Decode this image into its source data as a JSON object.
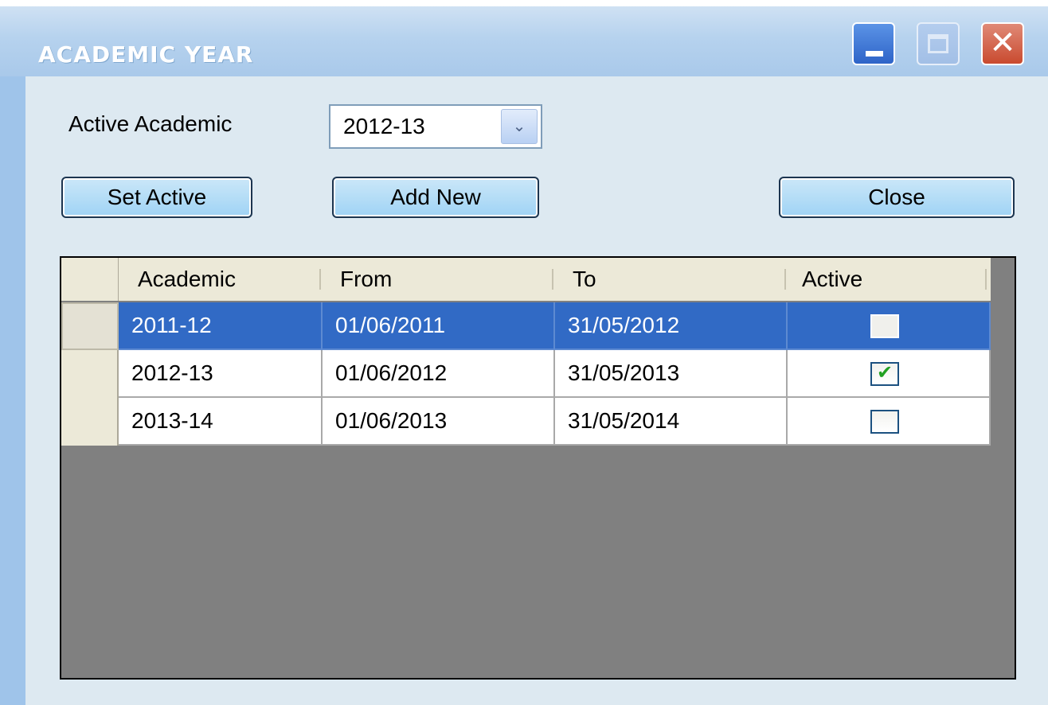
{
  "window": {
    "title": "ACADEMIC YEAR",
    "minimize_glyph": "",
    "close_glyph": "✕"
  },
  "form": {
    "active_label": "Active Academic",
    "active_value": "2012-13",
    "combo_arrow_glyph": "⌄"
  },
  "buttons": {
    "set_active": "Set Active",
    "add_new": "Add New",
    "close": "Close"
  },
  "grid": {
    "columns": [
      "Academic",
      "From",
      "To",
      "Active"
    ],
    "rows": [
      {
        "academic": "2011-12",
        "from": "01/06/2011",
        "to": "31/05/2012",
        "active": false,
        "active_mark": ""
      },
      {
        "academic": "2012-13",
        "from": "01/06/2012",
        "to": "31/05/2013",
        "active": true,
        "active_mark": "✔"
      },
      {
        "academic": "2013-14",
        "from": "01/06/2013",
        "to": "31/05/2014",
        "active": false,
        "active_mark": ""
      }
    ],
    "selected_row": 0
  },
  "colors": {
    "selection": "#316ac5",
    "grid_background": "#808080",
    "button_fill": "#9fd3f5",
    "check_green": "#21a121"
  }
}
